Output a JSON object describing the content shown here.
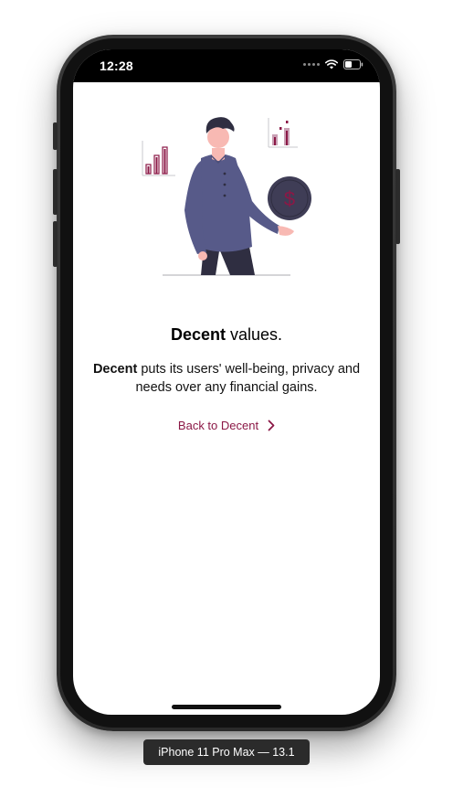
{
  "status_bar": {
    "time": "12:28"
  },
  "content": {
    "headline_bold": "Decent",
    "headline_rest": " values.",
    "body_bold": "Decent",
    "body_rest": " puts its users' well-being, privacy and needs over any financial gains.",
    "back_link_label": "Back to Decent"
  },
  "device": {
    "label": "iPhone 11 Pro Max — 13.1"
  },
  "icons": {
    "wifi": "wifi-icon",
    "battery": "battery-icon",
    "signal": "signal-dots-icon",
    "chevron": "chevron-right-icon",
    "dollar": "dollar-icon"
  },
  "colors": {
    "accent": "#8b1846",
    "illustration_person": "#575a89",
    "illustration_coin": "#3f3d56",
    "skin": "#f8b9b3",
    "hair": "#2f2e41"
  }
}
